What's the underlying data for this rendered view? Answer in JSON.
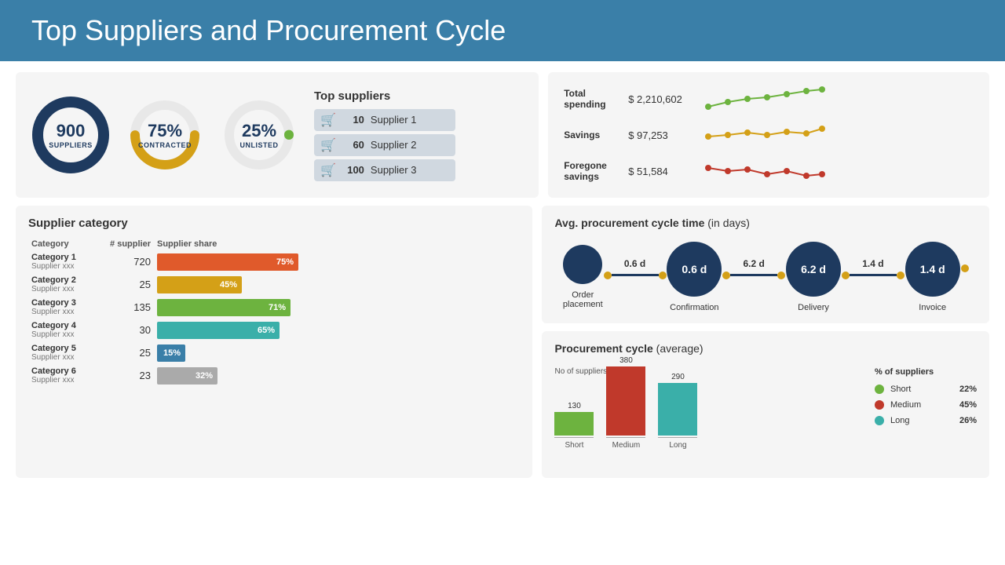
{
  "header": {
    "title": "Top Suppliers and Procurement Cycle"
  },
  "topLeft": {
    "donut1": {
      "value": "900",
      "label": "SUPPLIERS",
      "color": "#1e3a5f",
      "pct": 100
    },
    "donut2": {
      "value": "75%",
      "label": "CONTRACTED",
      "color": "#d4a017",
      "pct": 75
    },
    "donut3": {
      "value": "25%",
      "label": "UNLISTED",
      "color": "#6db33f",
      "pct": 25
    },
    "topSuppliersTitle": "Top suppliers",
    "suppliers": [
      {
        "num": "10",
        "name": "Supplier 1"
      },
      {
        "num": "60",
        "name": "Supplier 2"
      },
      {
        "num": "100",
        "name": "Supplier 3"
      }
    ]
  },
  "topRight": {
    "rows": [
      {
        "label": "Total spending",
        "value": "$ 2,210,602",
        "color": "#6db33f"
      },
      {
        "label": "Savings",
        "value": "$ 97,253",
        "color": "#d4a017"
      },
      {
        "label": "Foregone savings",
        "value": "$ 51,584",
        "color": "#c0392b"
      }
    ]
  },
  "supplierCategory": {
    "title": "Supplier category",
    "colCategory": "Category",
    "colSupplier": "# supplier",
    "colShare": "Supplier share",
    "rows": [
      {
        "name": "Category 1",
        "sub": "Supplier xxx",
        "num": "720",
        "pct": 75,
        "pctLabel": "75%",
        "color": "#e05a2b"
      },
      {
        "name": "Category 2",
        "sub": "Supplier xxx",
        "num": "25",
        "pct": 45,
        "pctLabel": "45%",
        "color": "#d4a017"
      },
      {
        "name": "Category 3",
        "sub": "Supplier xxx",
        "num": "135",
        "pct": 71,
        "pctLabel": "71%",
        "color": "#6db33f"
      },
      {
        "name": "Category 4",
        "sub": "Supplier xxx",
        "num": "30",
        "pct": 65,
        "pctLabel": "65%",
        "color": "#3aafa9"
      },
      {
        "name": "Category 5",
        "sub": "Supplier xxx",
        "num": "25",
        "pct": 15,
        "pctLabel": "15%",
        "color": "#3a7fa8"
      },
      {
        "name": "Category 6",
        "sub": "Supplier xxx",
        "num": "23",
        "pct": 32,
        "pctLabel": "32%",
        "color": "#aaaaaa"
      }
    ]
  },
  "procurementCycle": {
    "title": "Avg. procurement cycle time",
    "titleSuffix": " (in days)",
    "steps": [
      {
        "label": "Order\nplacement",
        "value": ""
      },
      {
        "duration": "0.6 d",
        "label": "Confirmation"
      },
      {
        "duration": "6.2 d",
        "label": "Delivery"
      },
      {
        "duration": "1.4 d",
        "label": "Invoice"
      }
    ]
  },
  "procurementAvg": {
    "title": "Procurement cycle",
    "titleSuffix": " (average)",
    "axisLabel": "No of suppliers",
    "bars": [
      {
        "label": "Short",
        "value": 130,
        "color": "#6db33f"
      },
      {
        "label": "Medium",
        "value": 380,
        "color": "#c0392b"
      },
      {
        "label": "Long",
        "value": 290,
        "color": "#3aafa9"
      }
    ],
    "legend": {
      "title": "% of suppliers",
      "items": [
        {
          "label": "Short",
          "pct": "22%",
          "color": "#6db33f"
        },
        {
          "label": "Medium",
          "pct": "45%",
          "color": "#c0392b"
        },
        {
          "label": "Long",
          "pct": "26%",
          "color": "#3aafa9"
        }
      ]
    }
  }
}
